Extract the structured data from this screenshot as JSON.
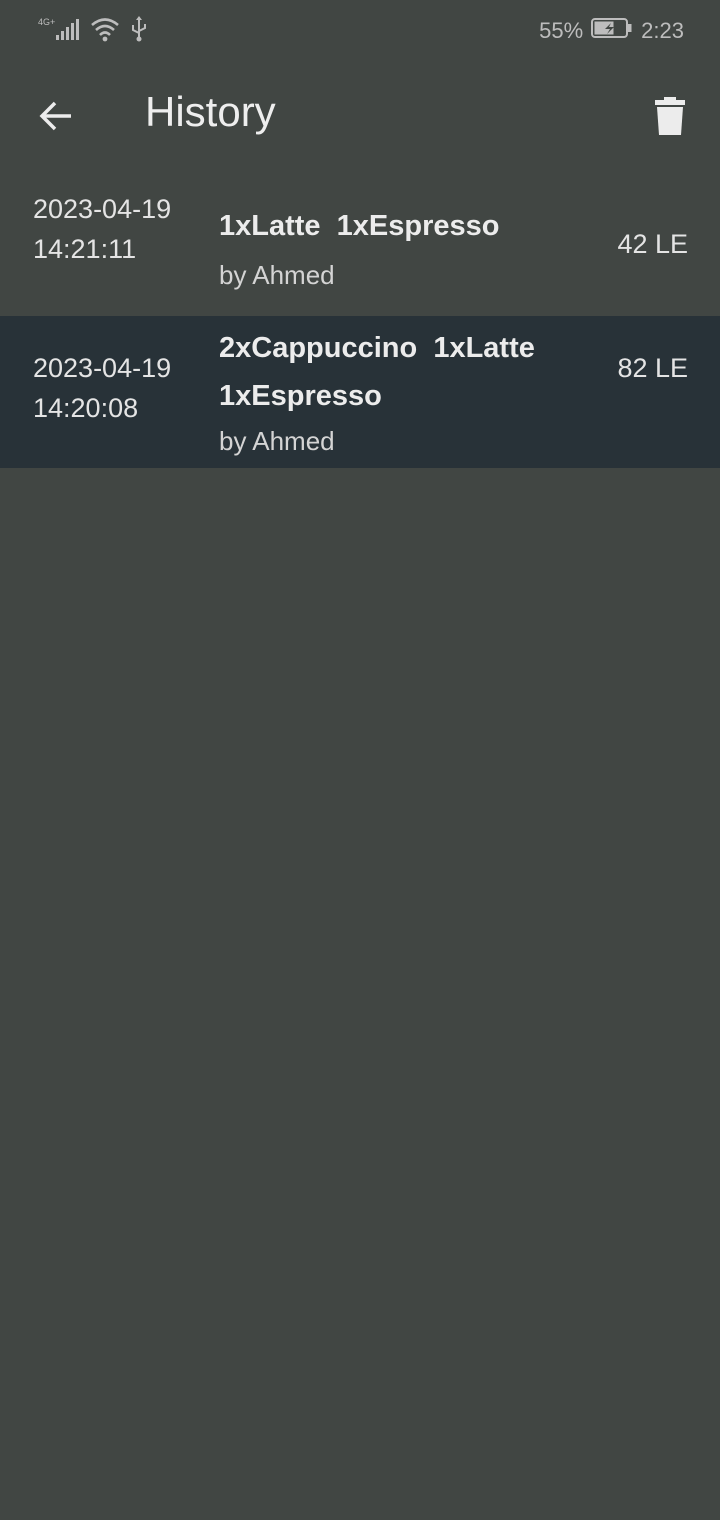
{
  "status_bar": {
    "network": "4G+",
    "battery": "55%",
    "time": "2:23",
    "icons": [
      "signal-icon",
      "wifi-icon",
      "usb-icon",
      "battery-icon"
    ]
  },
  "app_bar": {
    "title": "History",
    "back_icon": "arrow-back-icon",
    "delete_icon": "trash-icon"
  },
  "history": [
    {
      "date": "2023-04-19",
      "time": "14:21:11",
      "items": "1xLatte  1xEspresso",
      "by": "by Ahmed",
      "price": "42 LE"
    },
    {
      "date": "2023-04-19",
      "time": "14:20:08",
      "items": "2xCappuccino  1xLatte\n1xEspresso",
      "by": "by Ahmed",
      "price": "82 LE"
    }
  ],
  "colors": {
    "background": "#414643",
    "selected_row": "#283238",
    "text": "#e6e6e6"
  }
}
